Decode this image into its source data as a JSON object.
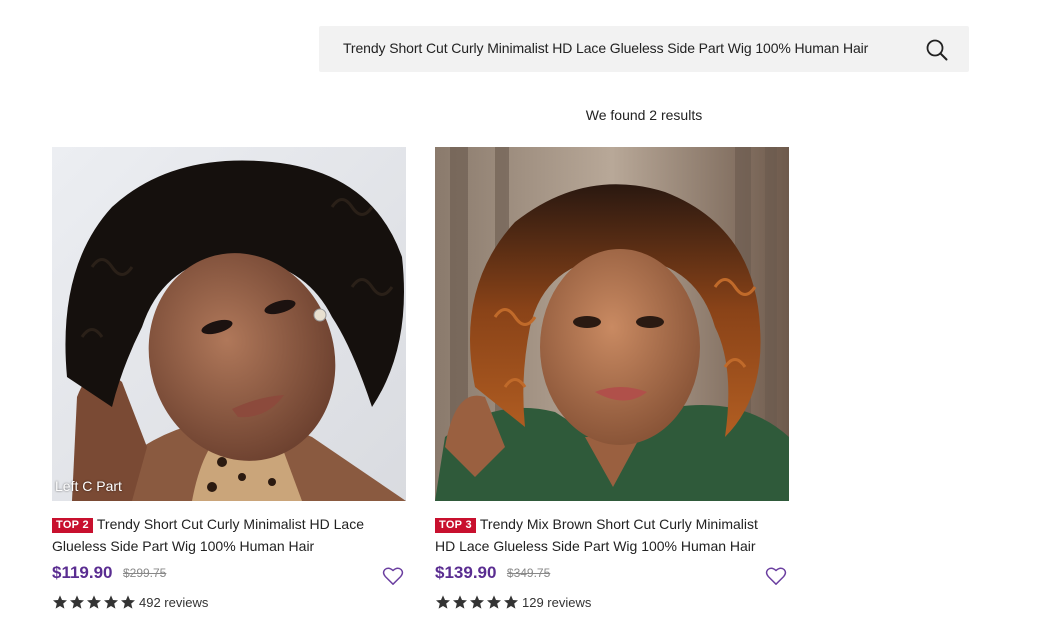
{
  "search": {
    "query": "Trendy Short Cut Curly Minimalist HD Lace Glueless Side Part Wig 100% Human Hair",
    "icon": "search-icon"
  },
  "results": {
    "summary": "We found 2 results"
  },
  "products": [
    {
      "badge": "TOP 2",
      "title": "Trendy Short Cut Curly Minimalist HD Lace Glueless Side Part Wig 100% Human Hair",
      "image_label": "Left C Part",
      "price": "$119.90",
      "old_price": "$299.75",
      "rating_stars": 5,
      "reviews": "492 reviews"
    },
    {
      "badge": "TOP 3",
      "title": "Trendy Mix Brown Short Cut Curly Minimalist HD Lace Glueless Side Part Wig 100% Human Hair",
      "image_label": "",
      "price": "$139.90",
      "old_price": "$349.75",
      "rating_stars": 5,
      "reviews": "129 reviews"
    }
  ],
  "colors": {
    "price": "#5a2d91",
    "badge": "#c8102e",
    "search_bg": "#f2f2f2",
    "star": "#333333"
  }
}
